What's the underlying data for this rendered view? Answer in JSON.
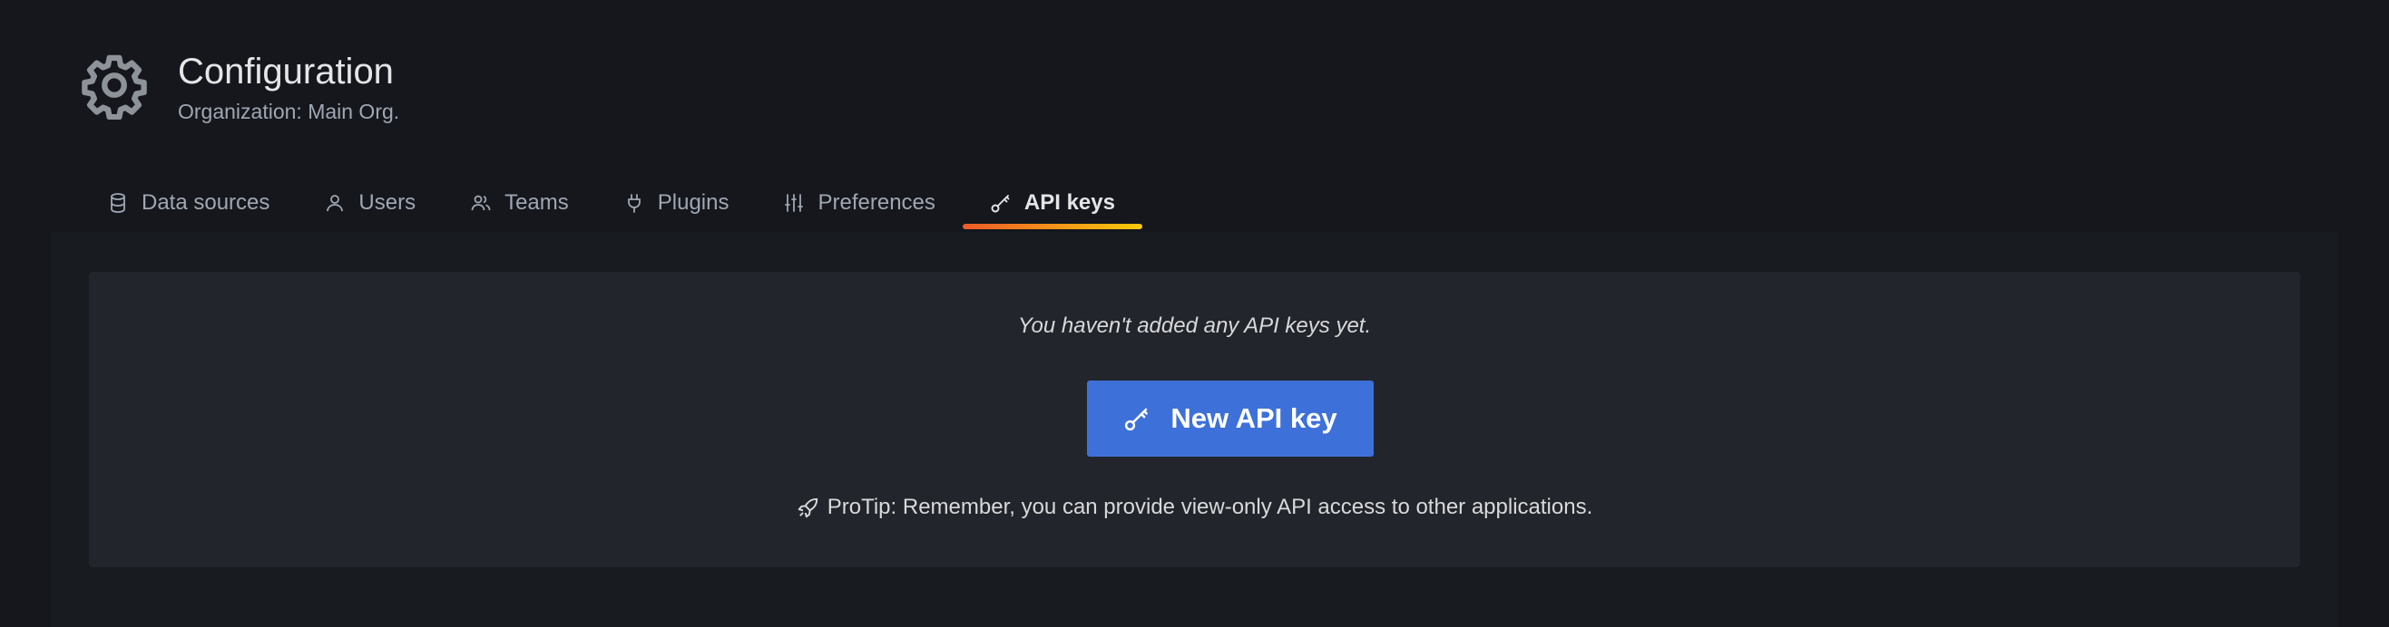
{
  "header": {
    "icon": "gear-icon",
    "title": "Configuration",
    "subtitle": "Organization: Main Org."
  },
  "tabs": [
    {
      "label": "Data sources",
      "icon": "database-icon",
      "active": false
    },
    {
      "label": "Users",
      "icon": "user-icon",
      "active": false
    },
    {
      "label": "Teams",
      "icon": "users-icon",
      "active": false
    },
    {
      "label": "Plugins",
      "icon": "plug-icon",
      "active": false
    },
    {
      "label": "Preferences",
      "icon": "sliders-icon",
      "active": false
    },
    {
      "label": "API keys",
      "icon": "key-icon",
      "active": true
    }
  ],
  "empty_state": {
    "message": "You haven't added any API keys yet.",
    "button_label": "New API key",
    "button_icon": "key-icon",
    "protip": "ProTip: Remember, you can provide view-only API access to other applications.",
    "protip_icon": "rocket-icon"
  },
  "colors": {
    "background": "#15171c",
    "card": "#22252b",
    "primary_button": "#3d71d9",
    "active_tab_underline": "#f05a28"
  }
}
